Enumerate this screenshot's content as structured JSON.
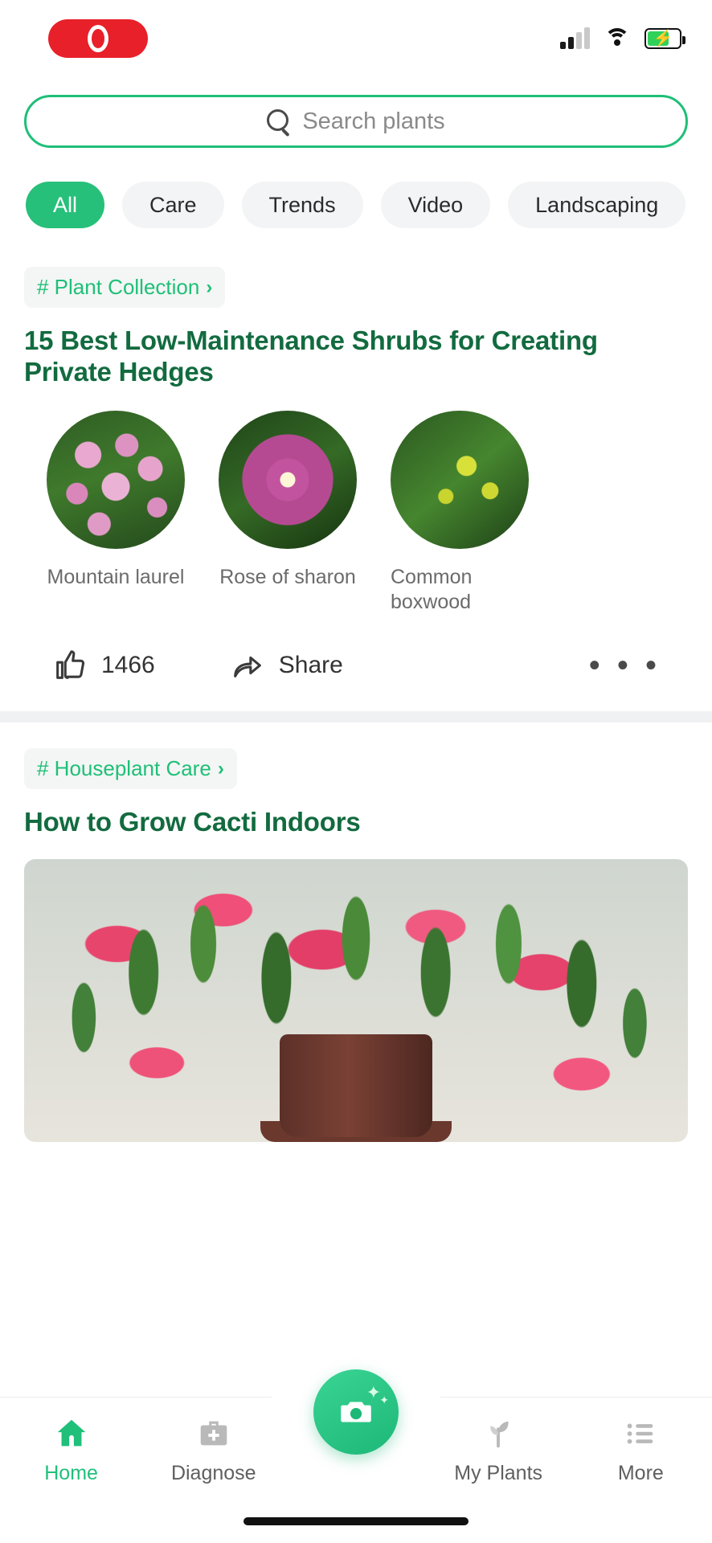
{
  "status_bar": {
    "recording_indicator": "recording-pill",
    "signal_icon": "cellular-signal-icon",
    "wifi_icon": "wifi-icon",
    "battery_icon": "battery-charging-icon",
    "battery_charging": true
  },
  "search": {
    "placeholder": "Search plants",
    "icon": "search-icon",
    "accent": "#1fbf78"
  },
  "categories": [
    {
      "label": "All",
      "active": true
    },
    {
      "label": "Care",
      "active": false
    },
    {
      "label": "Trends",
      "active": false
    },
    {
      "label": "Video",
      "active": false
    },
    {
      "label": "Landscaping",
      "active": false
    }
  ],
  "feed": [
    {
      "tag": "# Plant Collection",
      "tag_chevron": "›",
      "headline": "15 Best Low-Maintenance Shrubs for Creating Private Hedges",
      "plants": [
        {
          "name": "Mountain laurel"
        },
        {
          "name": "Rose of sharon"
        },
        {
          "name": "Common boxwood"
        }
      ],
      "like_count": "1466",
      "like_icon": "thumbs-up-icon",
      "share_label": "Share",
      "share_icon": "share-arrow-icon",
      "more_icon": "ellipsis-icon",
      "more_label": "• • •"
    },
    {
      "tag": "# Houseplant Care",
      "tag_chevron": "›",
      "headline": "How to Grow Cacti Indoors",
      "hero_alt": "christmas-cactus-in-pot"
    }
  ],
  "tabbar": {
    "items": [
      {
        "label": "Home",
        "icon": "home-icon",
        "active": true
      },
      {
        "label": "Diagnose",
        "icon": "first-aid-kit-icon",
        "active": false
      },
      {
        "label": "My Plants",
        "icon": "plant-sprout-icon",
        "active": false
      },
      {
        "label": "More",
        "icon": "list-menu-icon",
        "active": false
      }
    ],
    "camera_button": {
      "icon": "camera-icon",
      "sparkle": "✦",
      "sparkle_small": "✦"
    },
    "active_color": "#20c07a",
    "inactive_color": "#5f5f5f"
  }
}
